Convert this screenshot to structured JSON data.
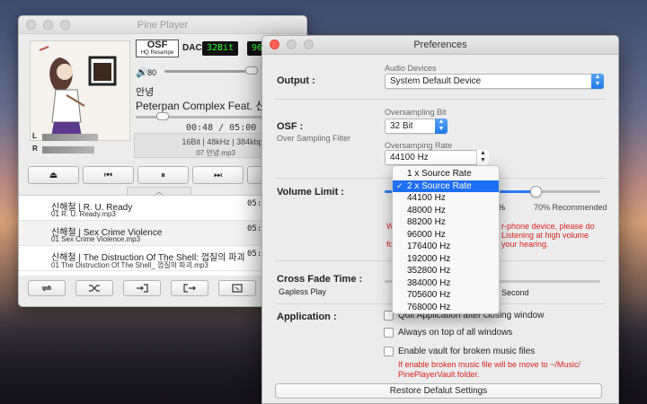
{
  "player": {
    "title": "Pine Player",
    "osf_label": "OSF",
    "osf_sub": "HQ Resampe",
    "dac_label": "DAC",
    "lcd_bit": "32Bit",
    "lcd_rate": "96",
    "volume_value": "80",
    "volume_level": 0.93,
    "artist": "안녕",
    "song_title": "Peterpan Complex Feat. 신해",
    "time": "00:48 / 05:00",
    "progress": 0.16,
    "meter_l_label": "L",
    "meter_r_label": "R",
    "format_info": "16Bit | 48kHz | 384kbps | MP",
    "file_info": "07 안녕.mp3",
    "controls": {
      "eject_icon": "⏏",
      "prev_icon": "⏮",
      "pause_icon": "⏸",
      "next_icon": "⏭"
    },
    "playlist": [
      {
        "title": "신해철 | R. U. Ready",
        "file": "01 R. U. Ready.mp3",
        "duration": "05:"
      },
      {
        "title": "신해철 | Sex Crime Violence",
        "file": "01 Sex Crime Violence.mp3",
        "duration": "05:"
      },
      {
        "title": "신해철 | The Distruction Of The Shell: 껍질의 파괴",
        "file": "01 The Distruction Of The Shell_ 껍질의 파괴.mp3",
        "duration": "05:"
      }
    ],
    "bottom_icons": [
      "repeat-icon",
      "shuffle-icon",
      "import-icon",
      "export-icon",
      "fullscreen-icon"
    ]
  },
  "prefs": {
    "title": "Preferences",
    "output_label": "Output :",
    "audio_devices_label": "Audio Devices",
    "audio_device_value": "System Default Device",
    "osf_label": "OSF :",
    "osf_sub": "Over Sampling Filter",
    "oversampling_bit_label": "Oversampling Bit",
    "oversampling_bit_value": "32 Bit",
    "oversampling_rate_label": "Oversamping Rate",
    "oversampling_rate_value": "44100 Hz",
    "volume_limit_label": "Volume Limit :",
    "volume_limit_level": 0.7,
    "volume_pct_fragment": "%",
    "volume_recommended": "70% Recommended",
    "warning_w": "W",
    "warning_f": "fo",
    "warning_1": "r-phone device, please do",
    "warning_2": "Listening at high volume",
    "warning_3": "your hearing.",
    "crossfade_label": "Cross Fade Time :",
    "crossfade_sub": "Gapless Play",
    "crossfade_second": "Second",
    "application_label": "Application :",
    "quit_option": "Quit Application after closing window",
    "always_on_top_option": "Always on top of all windows",
    "vault_option": "Enable vault for broken music files",
    "vault_note_1": "If enable broken music file will be move to ~/Music/",
    "vault_note_2": "PinePlayerVault folder.",
    "restore_button": "Restore Defalut Settings"
  },
  "rate_menu": {
    "items": [
      "1 x Source Rate",
      "2 x Source Rate",
      "44100 Hz",
      "48000 Hz",
      "88200 Hz",
      "96000 Hz",
      "176400 Hz",
      "192000 Hz",
      "352800 Hz",
      "384000 Hz",
      "705600 Hz",
      "768000 Hz"
    ],
    "selected_index": 1,
    "check_mark": "✓"
  }
}
